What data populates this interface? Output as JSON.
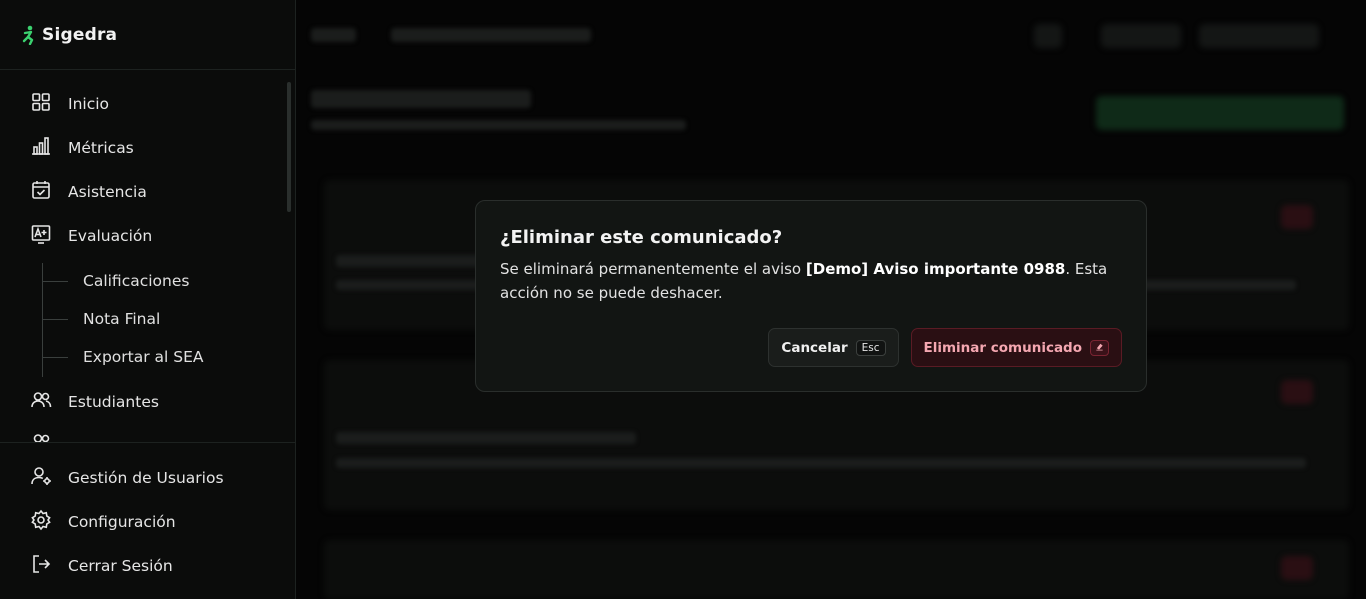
{
  "brand": {
    "name": "Sigedra",
    "accent": "#3bd16f"
  },
  "nav": {
    "items": [
      {
        "label": "Inicio",
        "icon": "grid-icon"
      },
      {
        "label": "Métricas",
        "icon": "bar-chart-icon"
      },
      {
        "label": "Asistencia",
        "icon": "calendar-check-icon"
      },
      {
        "label": "Evaluación",
        "icon": "grade-icon"
      }
    ],
    "sub_items": [
      "Calificaciones",
      "Nota Final",
      "Exportar al SEA"
    ],
    "after_items": [
      {
        "label": "Estudiantes",
        "icon": "users-icon"
      }
    ],
    "bottom": [
      {
        "label": "Gestión de Usuarios",
        "icon": "user-gear-icon"
      },
      {
        "label": "Configuración",
        "icon": "gear-icon"
      },
      {
        "label": "Cerrar Sesión",
        "icon": "logout-icon"
      }
    ]
  },
  "modal": {
    "title": "¿Eliminar este comunicado?",
    "body_prefix": "Se eliminará permanentemente el aviso ",
    "body_bold": "[Demo] Aviso importante 0988",
    "body_suffix": ". Esta acción no se puede deshacer.",
    "cancel_label": "Cancelar",
    "cancel_key": "Esc",
    "delete_label": "Eliminar comunicado",
    "danger_color": "#f4a7b1"
  }
}
